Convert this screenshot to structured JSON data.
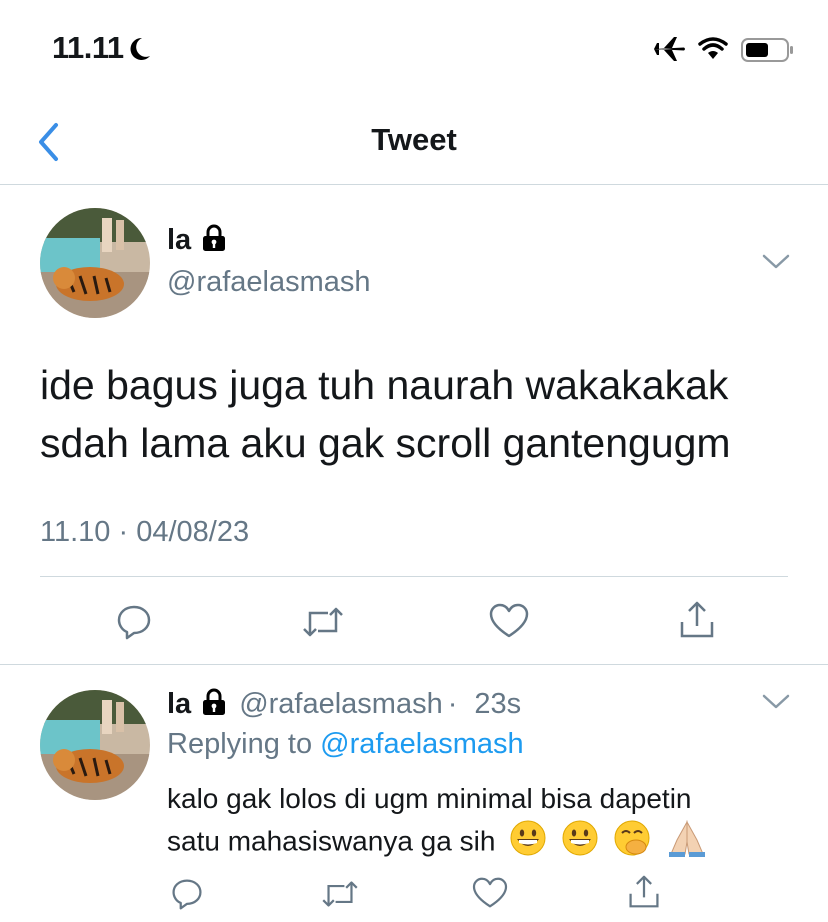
{
  "status_bar": {
    "time": "11.11",
    "icons": [
      "moon-icon",
      "airplane-icon",
      "wifi-icon",
      "battery-icon"
    ]
  },
  "nav": {
    "title": "Tweet",
    "back_icon": "chevron-left-icon",
    "accent_color": "#3a8ee6"
  },
  "main_tweet": {
    "display_name": "la",
    "lock_icon": "lock-icon",
    "handle": "@rafaelasmash",
    "text_line1": "ide bagus juga tuh naurah wakakakak",
    "text_line2": "sdah lama aku gak scroll gantengugm",
    "timestamp": "11.10 · 04/08/23",
    "actions": [
      "reply-icon",
      "retweet-icon",
      "like-icon",
      "share-icon"
    ]
  },
  "reply_tweet": {
    "display_name": "la",
    "handle": "@rafaelasmash",
    "separator": "·",
    "age": "23s",
    "replying_prefix": "Replying to",
    "replying_to": "@rafaelasmash",
    "text_line1": "kalo gak lolos di ugm minimal bisa dapetin",
    "text_line2": "satu mahasiswanya ga sih",
    "emojis": [
      "grinning-face",
      "grinning-face",
      "face-with-hand-over-mouth",
      "folded-hands"
    ],
    "actions": [
      "reply-icon",
      "retweet-icon",
      "like-icon",
      "share-icon"
    ]
  },
  "colors": {
    "text": "#14171a",
    "secondary": "#657786",
    "link": "#1d9bf0",
    "divider": "#cfd9de"
  }
}
